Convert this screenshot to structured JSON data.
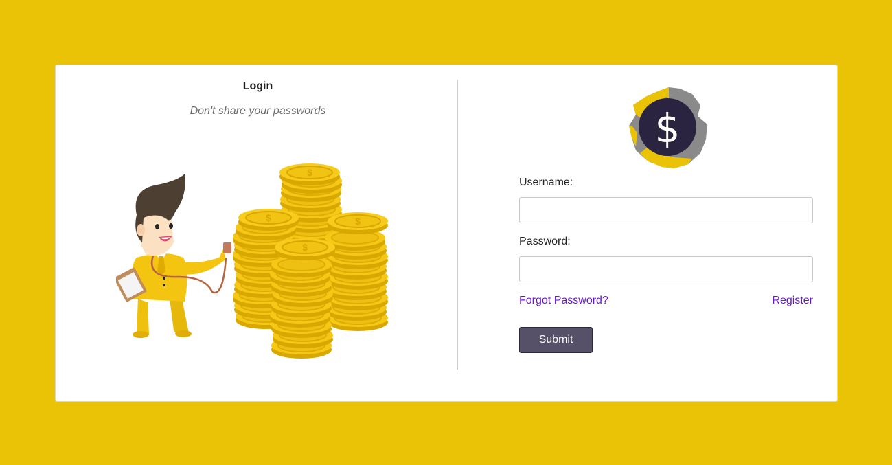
{
  "left": {
    "title": "Login",
    "subtitle": "Don't share your passwords"
  },
  "form": {
    "username_label": "Username:",
    "username_value": "",
    "password_label": "Password:",
    "password_value": "",
    "forgot_password": "Forgot Password?",
    "register": "Register",
    "submit": "Submit"
  },
  "logo": {
    "symbol": "$"
  },
  "colors": {
    "background": "#ebc306",
    "card": "#ffffff",
    "link": "#6a16d6",
    "button": "#565168",
    "coin": "#f2c40d"
  },
  "icons": {
    "logo": "dollar-coin-logo",
    "illustration": "businessman-with-coins"
  }
}
